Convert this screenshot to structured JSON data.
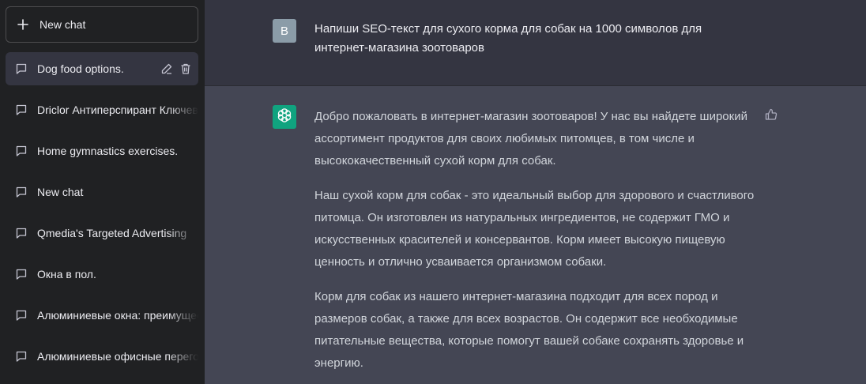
{
  "sidebar": {
    "new_chat_label": "New chat",
    "items": [
      {
        "label": "Dog food options.",
        "icon": "message-icon",
        "active": true
      },
      {
        "label": "Driclor Антиперспирант Ключевые",
        "icon": "message-icon"
      },
      {
        "label": "Home gymnastics exercises.",
        "icon": "message-icon"
      },
      {
        "label": "New chat",
        "icon": "message-icon"
      },
      {
        "label": "Qmedia's Targeted Advertising",
        "icon": "message-icon"
      },
      {
        "label": "Окна в пол.",
        "icon": "message-icon"
      },
      {
        "label": "Алюминиевые окна: преимущества",
        "icon": "message-icon"
      },
      {
        "label": "Алюминиевые офисные перегородки",
        "icon": "message-icon"
      }
    ]
  },
  "conversation": {
    "user": {
      "avatar_letter": "B",
      "message": "Напиши SEO-текст для сухого корма для собак на 1000 символов для интернет-магазина зоотоваров"
    },
    "assistant": {
      "paragraphs": [
        "Добро пожаловать в интернет-магазин зоотоваров! У нас вы найдете широкий ассортимент продуктов для своих любимых питомцев, в том числе и высококачественный сухой корм для собак.",
        "Наш сухой корм для собак - это идеальный выбор для здорового и счастливого питомца. Он изготовлен из натуральных ингредиентов, не содержит ГМО и искусственных красителей и консервантов. Корм имеет высокую пищевую ценность и отлично усваивается организмом собаки.",
        "Корм для собак из нашего интернет-магазина подходит для всех пород и размеров собак, а также для всех возрастов. Он содержит все необходимые питательные вещества, которые помогут вашей собаке сохранять здоровье и энергию."
      ]
    }
  },
  "colors": {
    "sidebar_bg": "#202123",
    "main_bg": "#343541",
    "assistant_bg": "#444654",
    "bot_avatar": "#10a37f",
    "user_avatar": "#8b9ca8"
  }
}
